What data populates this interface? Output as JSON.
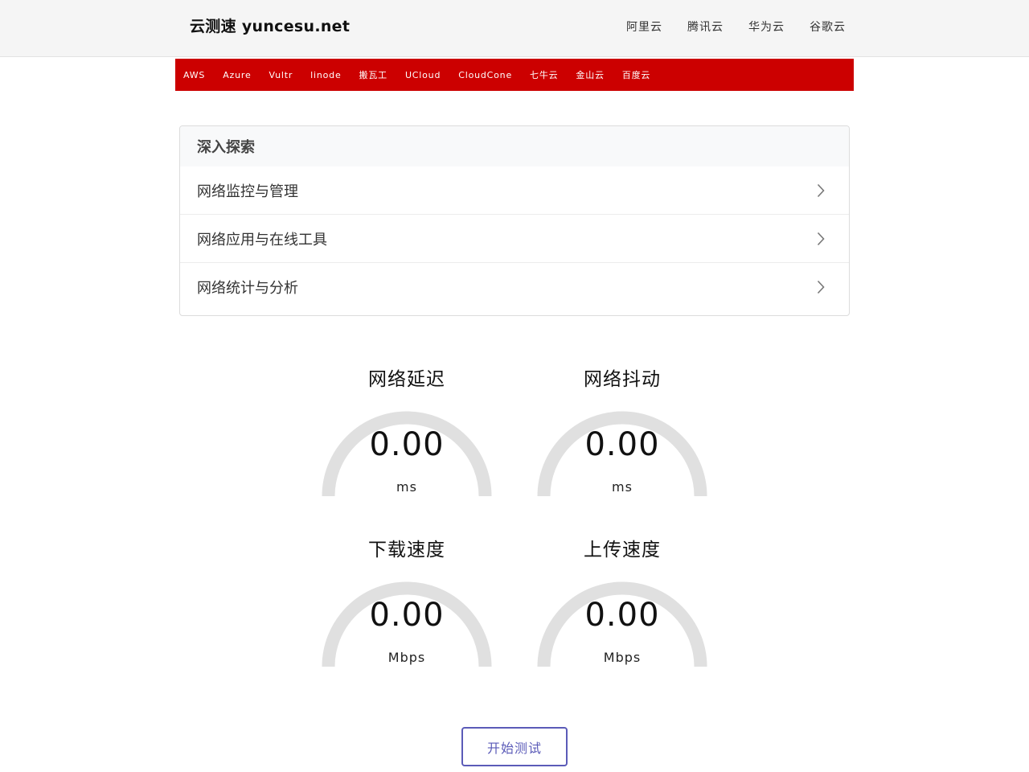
{
  "header": {
    "brand": "云测速 yuncesu.net",
    "nav": [
      "阿里云",
      "腾讯云",
      "华为云",
      "谷歌云"
    ]
  },
  "providers": [
    "AWS",
    "Azure",
    "Vultr",
    "linode",
    "搬瓦工",
    "UCloud",
    "CloudCone",
    "七牛云",
    "金山云",
    "百度云"
  ],
  "explore": {
    "title": "深入探索",
    "items": [
      "网络监控与管理",
      "网络应用与在线工具",
      "网络统计与分析"
    ]
  },
  "gauges": {
    "latency": {
      "title": "网络延迟",
      "value": "0.00",
      "unit": "ms"
    },
    "jitter": {
      "title": "网络抖动",
      "value": "0.00",
      "unit": "ms"
    },
    "download": {
      "title": "下载速度",
      "value": "0.00",
      "unit": "Mbps"
    },
    "upload": {
      "title": "上传速度",
      "value": "0.00",
      "unit": "Mbps"
    }
  },
  "start_button": "开始测试",
  "colors": {
    "provider_bar": "#cc0000",
    "gauge_track": "#e0e0e0",
    "button_accent": "#5b5bb8"
  }
}
